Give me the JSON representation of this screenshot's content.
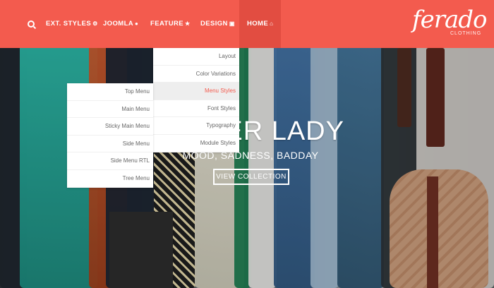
{
  "nav": {
    "items": [
      {
        "label": "EXT. STYLES",
        "icon": "gear-icon"
      },
      {
        "label": "JOOMLA",
        "icon": "user-icon"
      },
      {
        "label": "FEATURE",
        "icon": "star-icon"
      },
      {
        "label": "DESIGN",
        "icon": "image-icon"
      },
      {
        "label": "HOME",
        "icon": "home-icon"
      }
    ],
    "active": "HOME"
  },
  "logo": {
    "text": "ferado",
    "tagline": "CLOTHING"
  },
  "design_menu": {
    "items": [
      "Layout",
      "Color Variations",
      "Menu Styles",
      "Font Styles",
      "Typography",
      "Module Styles"
    ],
    "highlighted": "Menu Styles"
  },
  "menu_styles_submenu": {
    "items": [
      "Top Menu",
      "Main Menu",
      "Sticky Main Menu",
      "Side Menu",
      "Side Menu RTL",
      "Tree Menu"
    ]
  },
  "hero": {
    "title": "BER LADY",
    "subtitle": "MOOD, SADNESS, BADDAY",
    "button": "VIEW COLLECTION"
  },
  "colors": {
    "accent": "#f35b4e",
    "active_nav": "#e24d41"
  }
}
